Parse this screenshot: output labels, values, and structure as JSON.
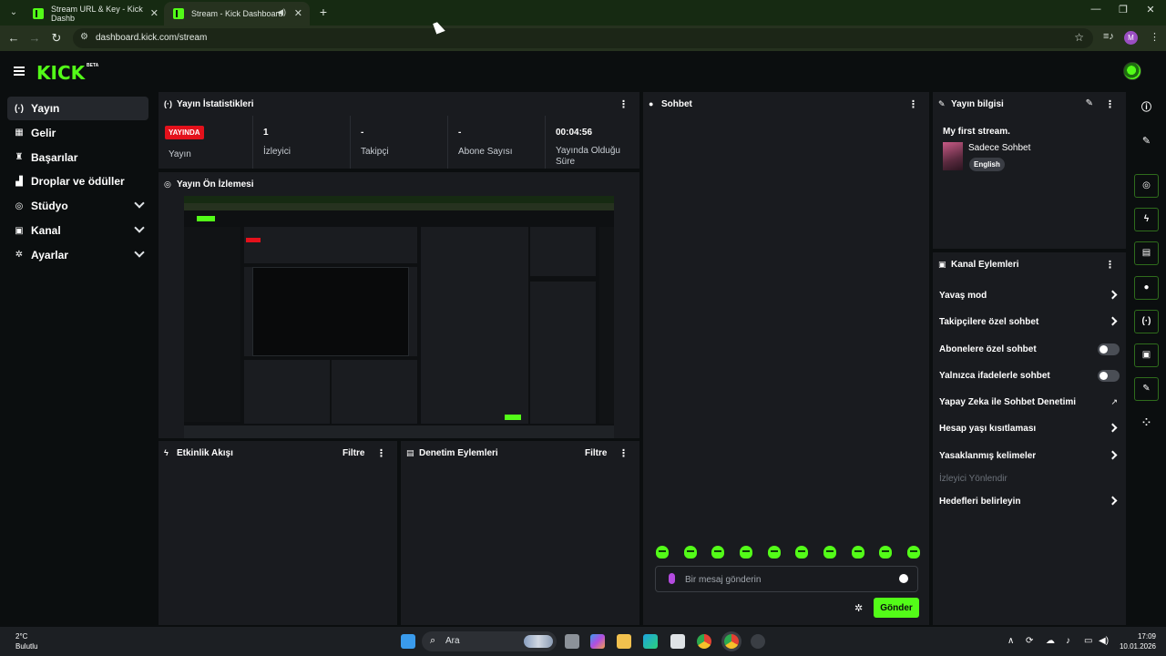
{
  "browser": {
    "tabs": [
      {
        "title": "Stream URL & Key - Kick Dashb",
        "active": false
      },
      {
        "title": "Stream - Kick Dashboard",
        "active": true
      }
    ],
    "url": "dashboard.kick.com/stream",
    "profile_initial": "M"
  },
  "brand": {
    "logo": "KICK",
    "beta": "BETA",
    "accent": "#53fc18",
    "live_red": "#e4111b"
  },
  "sidebar": {
    "items": [
      {
        "label": "Yayın",
        "icon": "broadcast-icon",
        "glyph": "(·)",
        "active": true,
        "expandable": false
      },
      {
        "label": "Gelir",
        "icon": "revenue-icon",
        "glyph": "▦",
        "active": false,
        "expandable": false
      },
      {
        "label": "Başarılar",
        "icon": "trophy-icon",
        "glyph": "♜",
        "active": false,
        "expandable": false
      },
      {
        "label": "Droplar ve ödüller",
        "icon": "drops-icon",
        "glyph": "▟",
        "active": false,
        "expandable": false
      },
      {
        "label": "Stüdyo",
        "icon": "studio-icon",
        "glyph": "◎",
        "active": false,
        "expandable": true
      },
      {
        "label": "Kanal",
        "icon": "channel-icon",
        "glyph": "▣",
        "active": false,
        "expandable": true
      },
      {
        "label": "Ayarlar",
        "icon": "settings-icon",
        "glyph": "✲",
        "active": false,
        "expandable": true
      }
    ]
  },
  "stats": {
    "title": "Yayın İstatistikleri",
    "live_badge": "YAYINDA",
    "cols": [
      {
        "value": "",
        "label": "Yayın"
      },
      {
        "value": "1",
        "label": "İzleyici"
      },
      {
        "value": "-",
        "label": "Takipçi"
      },
      {
        "value": "-",
        "label": "Abone Sayısı"
      },
      {
        "value": "00:04:56",
        "label": "Yayında Olduğu Süre"
      }
    ]
  },
  "preview": {
    "title": "Yayın Ön İzlemesi"
  },
  "events": {
    "title": "Etkinlik Akışı",
    "filter": "Filtre"
  },
  "mod_actions": {
    "title": "Denetim Eylemleri",
    "filter": "Filtre"
  },
  "chat": {
    "title": "Sohbet",
    "placeholder": "Bir mesaj gönderin",
    "send": "Gönder",
    "emote_count": 10
  },
  "stream_info": {
    "title": "Yayın bilgisi",
    "stream_title": "My first stream.",
    "category": "Sadece Sohbet",
    "language": "English"
  },
  "channel_actions": {
    "title": "Kanal Eylemleri",
    "items": [
      {
        "label": "Yavaş mod",
        "control": "chevron"
      },
      {
        "label": "Takipçilere özel sohbet",
        "control": "chevron"
      },
      {
        "label": "Abonelere özel sohbet",
        "control": "toggle",
        "on": false
      },
      {
        "label": "Yalnızca ifadelerle sohbet",
        "control": "toggle",
        "on": false
      },
      {
        "label": "Yapay Zeka ile Sohbet Denetimi",
        "control": "external"
      },
      {
        "label": "Hesap yaşı kısıtlaması",
        "control": "chevron"
      },
      {
        "label": "Yasaklanmış kelimeler",
        "control": "chevron"
      },
      {
        "label": "İzleyici Yönlendir",
        "control": "none",
        "disabled": true
      },
      {
        "label": "Hedefleri belirleyin",
        "control": "chevron"
      }
    ]
  },
  "taskbar": {
    "temp": "2°C",
    "weather": "Bulutlu",
    "search": "Ara",
    "time": "17:09",
    "date": "10.01.2026"
  }
}
